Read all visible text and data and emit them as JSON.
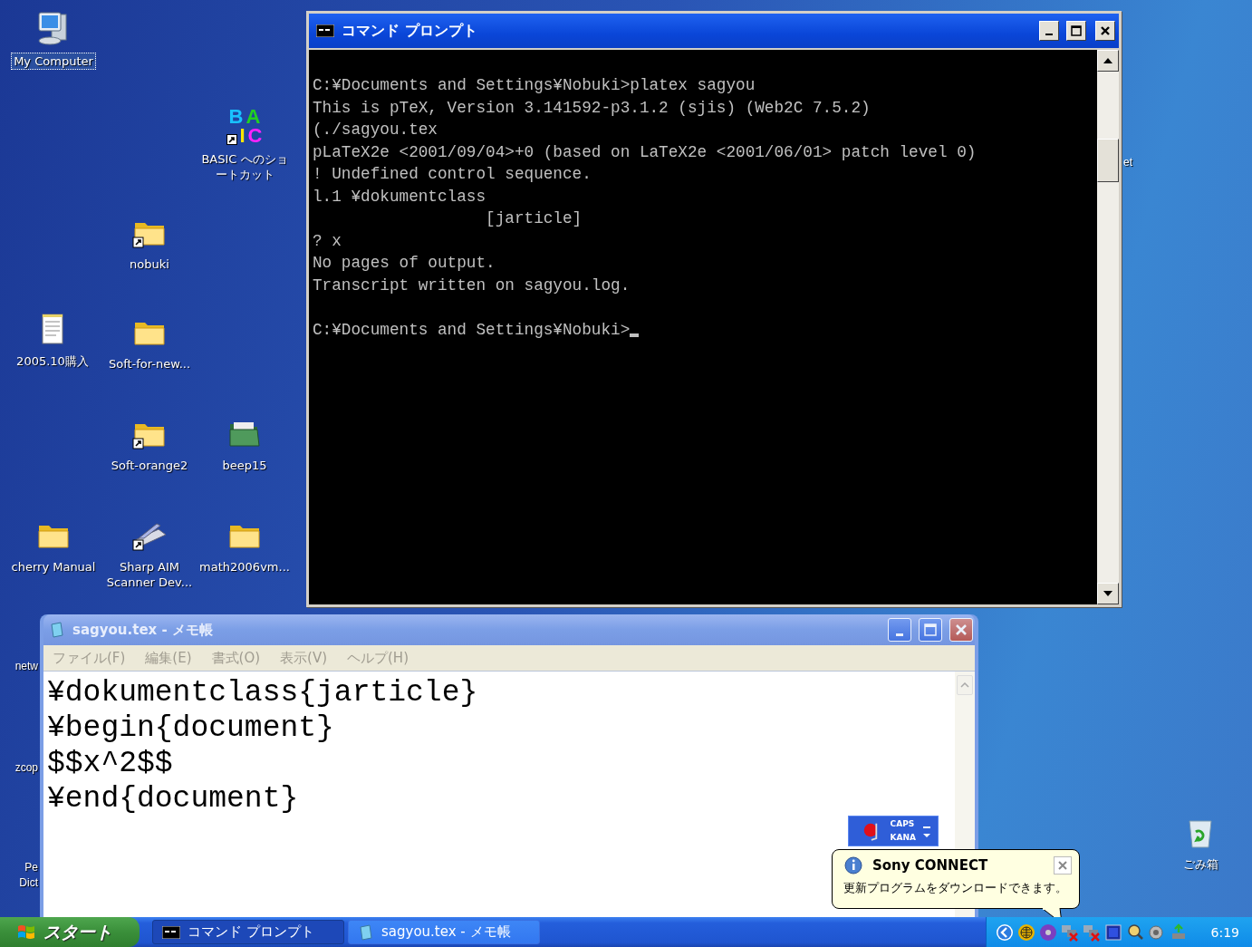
{
  "desktop_icons": [
    {
      "label": "My Computer",
      "kind": "computer",
      "shortcut": false,
      "selected": true
    },
    {
      "label": "BASIC へのショートカット",
      "kind": "basic",
      "logo_rows": [
        "BA",
        "IC"
      ],
      "shortcut": true,
      "selected": false
    },
    {
      "label": "nobuki",
      "kind": "folder",
      "shortcut": true,
      "selected": false
    },
    {
      "label": "2005.10購入",
      "kind": "text-file",
      "shortcut": false,
      "selected": false
    },
    {
      "label": "Soft-for-new...",
      "kind": "folder",
      "shortcut": false,
      "selected": false
    },
    {
      "label": "Soft-orange2",
      "kind": "folder",
      "shortcut": true,
      "selected": false
    },
    {
      "label": "beep15",
      "kind": "green-folder",
      "shortcut": false,
      "selected": false
    },
    {
      "label": "cherry Manual",
      "kind": "folder",
      "shortcut": false,
      "selected": false
    },
    {
      "label": "Sharp AIM Scanner Dev...",
      "kind": "scanner",
      "shortcut": true,
      "selected": false
    },
    {
      "label": "math2006vm...",
      "kind": "folder",
      "shortcut": false,
      "selected": false
    }
  ],
  "partial_labels": [
    "netw",
    "zcop",
    "Pe Dict",
    "et"
  ],
  "recycle_bin": {
    "label": "ごみ箱"
  },
  "command_prompt": {
    "title": "コマンド プロンプト",
    "active": true,
    "output": [
      "C:¥Documents and Settings¥Nobuki>platex sagyou",
      "This is pTeX, Version 3.141592-p3.1.2 (sjis) (Web2C 7.5.2)",
      "(./sagyou.tex",
      "pLaTeX2e <2001/09/04>+0 (based on LaTeX2e <2001/06/01> patch level 0)",
      "! Undefined control sequence.",
      "l.1 ¥dokumentclass",
      "                  [jarticle]",
      "? x",
      "No pages of output.",
      "Transcript written on sagyou.log."
    ],
    "prompt": "C:¥Documents and Settings¥Nobuki>"
  },
  "notepad": {
    "title": "sagyou.tex - メモ帳",
    "active": false,
    "menu": [
      "ファイル(F)",
      "編集(E)",
      "書式(O)",
      "表示(V)",
      "ヘルプ(H)"
    ],
    "lines": [
      "¥dokumentclass{jarticle}",
      "¥begin{document}",
      "$$x^2$$",
      "¥end{document}"
    ]
  },
  "ime_bar": {
    "caps": "CAPS",
    "kana": "KANA"
  },
  "balloon": {
    "title": "Sony CONNECT",
    "message": "更新プログラムをダウンロードできます。"
  },
  "taskbar": {
    "start": "スタート",
    "buttons": [
      {
        "label": "コマンド プロンプト",
        "kind": "console",
        "selected": true
      },
      {
        "label": "sagyou.tex - メモ帳",
        "kind": "notepad",
        "selected": false
      }
    ],
    "clock": "6:19"
  }
}
